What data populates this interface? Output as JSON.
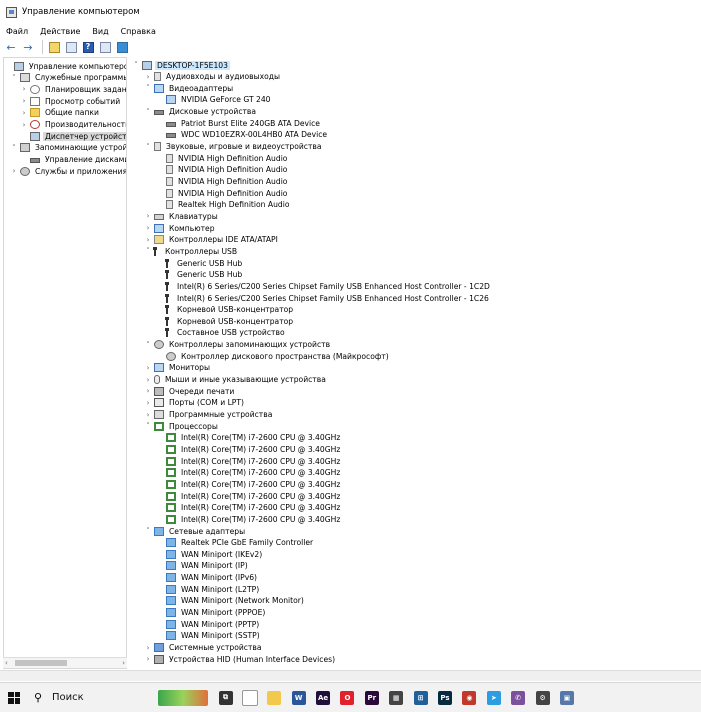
{
  "window": {
    "title": "Управление компьютером"
  },
  "menu": [
    "Файл",
    "Действие",
    "Вид",
    "Справка"
  ],
  "left_tree": [
    {
      "label": "Управление компьютером (л",
      "icon": "computer-management-icon",
      "chev": "",
      "level": 0
    },
    {
      "label": "Служебные программы",
      "icon": "tools-icon",
      "chev": "expanded",
      "level": 1
    },
    {
      "label": "Планировщик заданий",
      "icon": "clock-icon",
      "chev": "collapsed",
      "level": 2
    },
    {
      "label": "Просмотр событий",
      "icon": "event-viewer-icon",
      "chev": "collapsed",
      "level": 2
    },
    {
      "label": "Общие папки",
      "icon": "folder-icon",
      "chev": "collapsed",
      "level": 2
    },
    {
      "label": "Производительность",
      "icon": "performance-icon",
      "chev": "collapsed",
      "level": 2
    },
    {
      "label": "Диспетчер устройств",
      "icon": "device-manager-icon",
      "chev": "",
      "level": 2,
      "selected": true
    },
    {
      "label": "Запоминающие устройст",
      "icon": "storage-icon",
      "chev": "expanded",
      "level": 1
    },
    {
      "label": "Управление дисками",
      "icon": "disk-management-icon",
      "chev": "",
      "level": 2
    },
    {
      "label": "Службы и приложения",
      "icon": "services-icon",
      "chev": "collapsed",
      "level": 1
    }
  ],
  "device_tree": [
    {
      "label": "DESKTOP-1F5E103",
      "icon": "computer-icon",
      "chev": "expanded",
      "level": 0,
      "root": true
    },
    {
      "label": "Аудиовходы и аудиовыходы",
      "icon": "audio-io-icon",
      "chev": "collapsed",
      "level": 1
    },
    {
      "label": "Видеоадаптеры",
      "icon": "display-adapter-icon",
      "chev": "expanded",
      "level": 1
    },
    {
      "label": "NVIDIA GeForce GT 240",
      "icon": "display-adapter-icon",
      "chev": "",
      "level": 2
    },
    {
      "label": "Дисковые устройства",
      "icon": "disk-icon",
      "chev": "expanded",
      "level": 1
    },
    {
      "label": "Patriot Burst Elite 240GB ATA Device",
      "icon": "disk-icon",
      "chev": "",
      "level": 2
    },
    {
      "label": "WDC WD10EZRX-00L4HB0 ATA Device",
      "icon": "disk-icon",
      "chev": "",
      "level": 2
    },
    {
      "label": "Звуковые, игровые и видеоустройства",
      "icon": "speaker-icon",
      "chev": "expanded",
      "level": 1
    },
    {
      "label": "NVIDIA High Definition Audio",
      "icon": "speaker-icon",
      "chev": "",
      "level": 2
    },
    {
      "label": "NVIDIA High Definition Audio",
      "icon": "speaker-icon",
      "chev": "",
      "level": 2
    },
    {
      "label": "NVIDIA High Definition Audio",
      "icon": "speaker-icon",
      "chev": "",
      "level": 2
    },
    {
      "label": "NVIDIA High Definition Audio",
      "icon": "speaker-icon",
      "chev": "",
      "level": 2
    },
    {
      "label": "Realtek High Definition Audio",
      "icon": "speaker-icon",
      "chev": "",
      "level": 2
    },
    {
      "label": "Клавиатуры",
      "icon": "keyboard-icon",
      "chev": "collapsed",
      "level": 1
    },
    {
      "label": "Компьютер",
      "icon": "monitor-icon",
      "chev": "collapsed",
      "level": 1
    },
    {
      "label": "Контроллеры IDE ATA/ATAPI",
      "icon": "ide-controller-icon",
      "chev": "collapsed",
      "level": 1
    },
    {
      "label": "Контроллеры USB",
      "icon": "usb-icon",
      "chev": "expanded",
      "level": 1
    },
    {
      "label": "Generic USB Hub",
      "icon": "usb-icon",
      "chev": "",
      "level": 2
    },
    {
      "label": "Generic USB Hub",
      "icon": "usb-icon",
      "chev": "",
      "level": 2
    },
    {
      "label": "Intel(R) 6 Series/C200 Series Chipset Family USB Enhanced Host Controller - 1C2D",
      "icon": "usb-icon",
      "chev": "",
      "level": 2
    },
    {
      "label": "Intel(R) 6 Series/C200 Series Chipset Family USB Enhanced Host Controller - 1C26",
      "icon": "usb-icon",
      "chev": "",
      "level": 2
    },
    {
      "label": "Корневой USB-концентратор",
      "icon": "usb-icon",
      "chev": "",
      "level": 2
    },
    {
      "label": "Корневой USB-концентратор",
      "icon": "usb-icon",
      "chev": "",
      "level": 2
    },
    {
      "label": "Составное USB устройство",
      "icon": "usb-icon",
      "chev": "",
      "level": 2
    },
    {
      "label": "Контроллеры запоминающих устройств",
      "icon": "storage-controller-icon",
      "chev": "expanded",
      "level": 1
    },
    {
      "label": "Контроллер дискового пространства (Майкрософт)",
      "icon": "storage-controller-icon",
      "chev": "",
      "level": 2
    },
    {
      "label": "Мониторы",
      "icon": "monitor-icon",
      "chev": "collapsed",
      "level": 1
    },
    {
      "label": "Мыши и иные указывающие устройства",
      "icon": "mouse-icon",
      "chev": "collapsed",
      "level": 1
    },
    {
      "label": "Очереди печати",
      "icon": "printer-icon",
      "chev": "collapsed",
      "level": 1
    },
    {
      "label": "Порты (COM и LPT)",
      "icon": "port-icon",
      "chev": "collapsed",
      "level": 1
    },
    {
      "label": "Программные устройства",
      "icon": "software-device-icon",
      "chev": "collapsed",
      "level": 1
    },
    {
      "label": "Процессоры",
      "icon": "cpu-icon",
      "chev": "expanded",
      "level": 1
    },
    {
      "label": "Intel(R) Core(TM) i7-2600 CPU @ 3.40GHz",
      "icon": "cpu-icon",
      "chev": "",
      "level": 2
    },
    {
      "label": "Intel(R) Core(TM) i7-2600 CPU @ 3.40GHz",
      "icon": "cpu-icon",
      "chev": "",
      "level": 2
    },
    {
      "label": "Intel(R) Core(TM) i7-2600 CPU @ 3.40GHz",
      "icon": "cpu-icon",
      "chev": "",
      "level": 2
    },
    {
      "label": "Intel(R) Core(TM) i7-2600 CPU @ 3.40GHz",
      "icon": "cpu-icon",
      "chev": "",
      "level": 2
    },
    {
      "label": "Intel(R) Core(TM) i7-2600 CPU @ 3.40GHz",
      "icon": "cpu-icon",
      "chev": "",
      "level": 2
    },
    {
      "label": "Intel(R) Core(TM) i7-2600 CPU @ 3.40GHz",
      "icon": "cpu-icon",
      "chev": "",
      "level": 2
    },
    {
      "label": "Intel(R) Core(TM) i7-2600 CPU @ 3.40GHz",
      "icon": "cpu-icon",
      "chev": "",
      "level": 2
    },
    {
      "label": "Intel(R) Core(TM) i7-2600 CPU @ 3.40GHz",
      "icon": "cpu-icon",
      "chev": "",
      "level": 2
    },
    {
      "label": "Сетевые адаптеры",
      "icon": "network-adapter-icon",
      "chev": "expanded",
      "level": 1
    },
    {
      "label": "Realtek PCIe GbE Family Controller",
      "icon": "network-adapter-icon",
      "chev": "",
      "level": 2
    },
    {
      "label": "WAN Miniport (IKEv2)",
      "icon": "network-adapter-icon",
      "chev": "",
      "level": 2
    },
    {
      "label": "WAN Miniport (IP)",
      "icon": "network-adapter-icon",
      "chev": "",
      "level": 2
    },
    {
      "label": "WAN Miniport (IPv6)",
      "icon": "network-adapter-icon",
      "chev": "",
      "level": 2
    },
    {
      "label": "WAN Miniport (L2TP)",
      "icon": "network-adapter-icon",
      "chev": "",
      "level": 2
    },
    {
      "label": "WAN Miniport (Network Monitor)",
      "icon": "network-adapter-icon",
      "chev": "",
      "level": 2
    },
    {
      "label": "WAN Miniport (PPPOE)",
      "icon": "network-adapter-icon",
      "chev": "",
      "level": 2
    },
    {
      "label": "WAN Miniport (PPTP)",
      "icon": "network-adapter-icon",
      "chev": "",
      "level": 2
    },
    {
      "label": "WAN Miniport (SSTP)",
      "icon": "network-adapter-icon",
      "chev": "",
      "level": 2
    },
    {
      "label": "Системные устройства",
      "icon": "system-device-icon",
      "chev": "collapsed",
      "level": 1
    },
    {
      "label": "Устройства HID (Human Interface Devices)",
      "icon": "hid-icon",
      "chev": "collapsed",
      "level": 1
    }
  ],
  "taskbar": {
    "search_label": "Поиск",
    "apps": [
      {
        "name": "task-view-icon",
        "color": "#333333",
        "glyph": "⧉"
      },
      {
        "name": "file-icon",
        "color": "#ffffff",
        "glyph": ""
      },
      {
        "name": "explorer-icon",
        "color": "#f2c94c",
        "glyph": ""
      },
      {
        "name": "word-icon",
        "color": "#2b579a",
        "glyph": "W"
      },
      {
        "name": "after-effects-icon",
        "color": "#1f0f3a",
        "glyph": "Ae"
      },
      {
        "name": "opera-icon",
        "color": "#e0222b",
        "glyph": "O"
      },
      {
        "name": "premiere-icon",
        "color": "#2a0a3a",
        "glyph": "Pr"
      },
      {
        "name": "calculator-icon",
        "color": "#444444",
        "glyph": "▦"
      },
      {
        "name": "network-tool-icon",
        "color": "#1f5f9a",
        "glyph": "⊞"
      },
      {
        "name": "photoshop-icon",
        "color": "#062b3f",
        "glyph": "Ps"
      },
      {
        "name": "davinci-icon",
        "color": "#c0392b",
        "glyph": "◉"
      },
      {
        "name": "telegram-icon",
        "color": "#2a9ee0",
        "glyph": "➤"
      },
      {
        "name": "viber-icon",
        "color": "#7b519d",
        "glyph": "✆"
      },
      {
        "name": "settings-icon",
        "color": "#444444",
        "glyph": "⚙"
      },
      {
        "name": "device-icon",
        "color": "#5577aa",
        "glyph": "▣"
      }
    ]
  }
}
